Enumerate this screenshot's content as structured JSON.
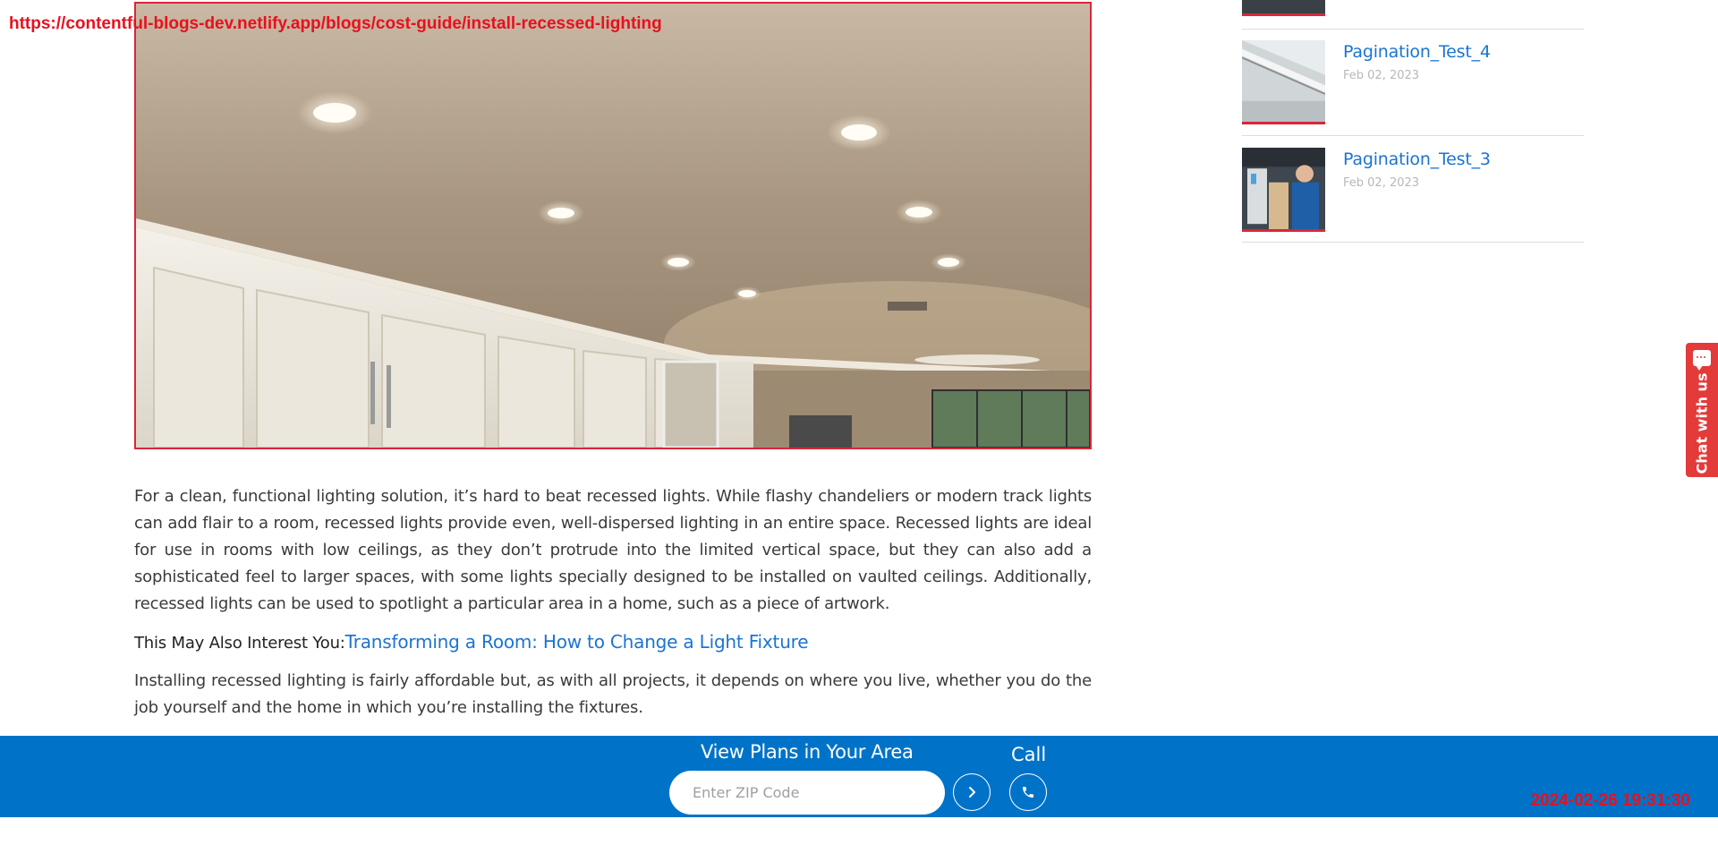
{
  "overlay": {
    "url": "https://contentful-blogs-dev.netlify.app/blogs/cost-guide/install-recessed-lighting",
    "timestamp": "2024-02-26 19:31:30"
  },
  "hero": {
    "image": "recessed-lights-kitchen-ceiling-photo"
  },
  "article": {
    "paragraph1": "For a clean, functional lighting solution, it’s hard to beat recessed lights. While flashy chandeliers or modern track lights can add flair to a room, recessed lights provide even, well-dispersed lighting in an entire space. Recessed lights are ideal for use in rooms with low ceilings, as they don’t protrude into the limited vertical space, but they can also add a sophisticated feel to larger spaces, with some lights specially designed to be installed on vaulted ceilings. Additionally, recessed lights can be used to spotlight a particular area in a home, such as a piece of artwork.",
    "interest_label": "This May Also Interest You:",
    "interest_link": "Transforming a Room: How to Change a Light Fixture",
    "paragraph2": "Installing recessed lighting is fairly affordable but, as with all projects, it depends on where you live, whether you do the job yourself and the home in which you’re installing the fixtures."
  },
  "sidebar": {
    "items": [
      {
        "title": "Pagination_Test_4",
        "date": "Feb 02, 2023",
        "thumb": "house-gutter-photo"
      },
      {
        "title": "Pagination_Test_3",
        "date": "Feb 02, 2023",
        "thumb": "technician-fridge-photo"
      }
    ]
  },
  "chat": {
    "label": "Chat with us",
    "icon": "chat-bubble-icon"
  },
  "plans_bar": {
    "title": "View Plans in Your Area",
    "zip_placeholder": "Enter ZIP Code",
    "zip_value": "",
    "go_icon": "chevron-right-icon",
    "call_label": "Call",
    "call_icon": "phone-icon",
    "background": "#0073c8"
  },
  "colors": {
    "accent_red": "#d7273a",
    "link_blue": "#1b74d1"
  }
}
